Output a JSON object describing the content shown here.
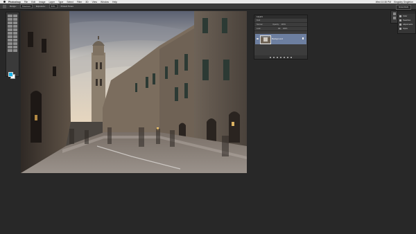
{
  "menubar": {
    "app_name": "Photoshop",
    "items": [
      "File",
      "Edit",
      "Image",
      "Layer",
      "Type",
      "Select",
      "Filter",
      "3D",
      "View",
      "Window",
      "Help"
    ],
    "clock": "Wed 10:38 PM",
    "user": "Kingsley Singleton"
  },
  "options_bar": {
    "tool_name": "move-tool",
    "range_label": "Range:",
    "range_value": "Shadows",
    "exposure_label": "Exposure:",
    "exposure_value": "50%",
    "protect_tones": "Protect Tones",
    "workspace": "Essentials"
  },
  "toolbar": {
    "tool_count": 22,
    "foreground_color": "#1ab3e8",
    "background_color": "#ffffff"
  },
  "layers_panel": {
    "tab": "Layers",
    "kind_label": "Kind",
    "blend_mode": "Normal",
    "opacity_label": "Opacity:",
    "opacity_value": "100%",
    "lock_label": "Lock:",
    "fill_label": "Fill:",
    "fill_value": "100%",
    "layer_name": "Background"
  },
  "right_dock": {
    "items": [
      "Color",
      "Swatches",
      "Adjustments",
      "Styles"
    ]
  },
  "colors": {
    "app_bg": "#282828",
    "panel_bg": "#3c3c3c",
    "layer_selected": "#6d7fa0",
    "menubar_bg": "#e9e9e9"
  }
}
